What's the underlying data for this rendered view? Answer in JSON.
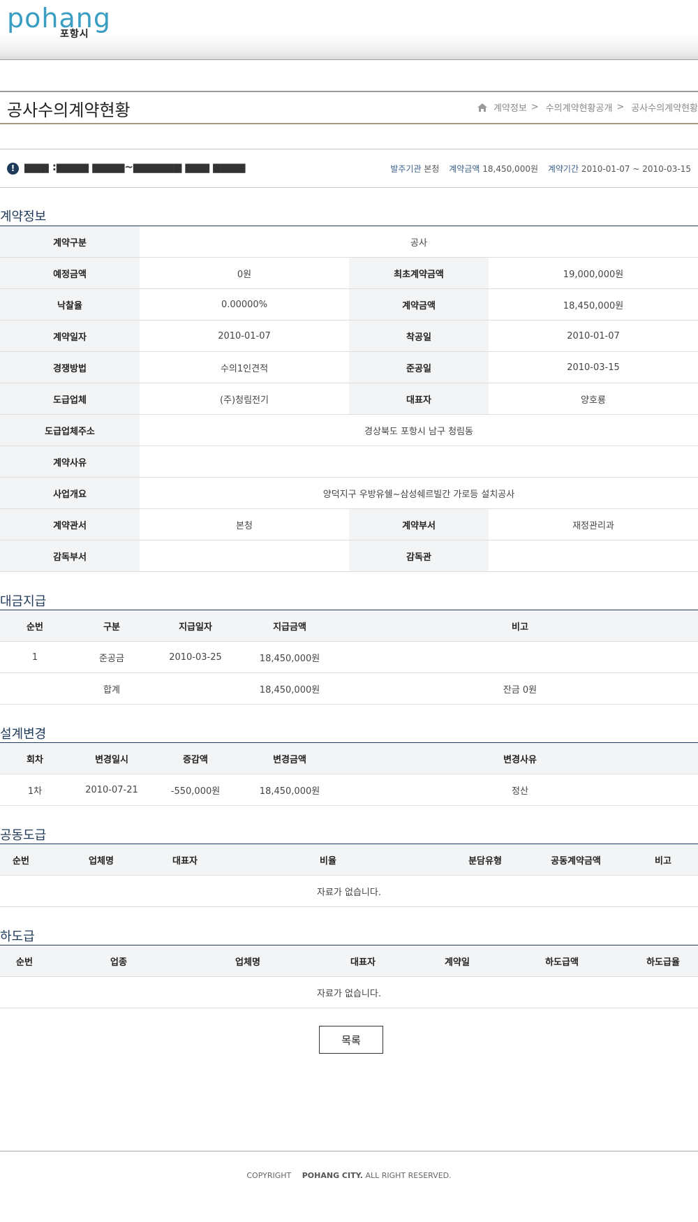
{
  "header": {
    "logo_text": "pohang",
    "logo_kor": "포항시"
  },
  "title_bar": {
    "title": "공사수의계약현황",
    "breadcrumb": [
      "계약정보",
      "수의계약현황공개",
      "공사수의계약현황"
    ],
    "separator": ">"
  },
  "summary": {
    "title": "▆▆▆ :▆▆▆▆ ▆▆▆▆~▆▆▆▆▆▆ ▆▆▆ ▆▆▆▆",
    "org_label": "발주기관",
    "org_value": "본청",
    "amount_label": "계약금액",
    "amount_value": "18,450,000원",
    "period_label": "계약기간",
    "period_value": "2010-01-07 ~ 2010-03-15"
  },
  "contract_info": {
    "heading": "계약정보",
    "type_label": "계약구분",
    "type_value": "공사",
    "est_label": "예정금액",
    "est_value": "0원",
    "first_amount_label": "최초계약금액",
    "first_amount_value": "19,000,000원",
    "rate_label": "낙찰율",
    "rate_value": "0.00000%",
    "amount_label": "계약금액",
    "amount_value": "18,450,000원",
    "date_label": "계약일자",
    "date_value": "2010-01-07",
    "start_label": "착공일",
    "start_value": "2010-01-07",
    "method_label": "경쟁방법",
    "method_value": "수의1인견적",
    "end_label": "준공일",
    "end_value": "2010-03-15",
    "company_label": "도급업체",
    "company_value": "(주)청림전기",
    "ceo_label": "대표자",
    "ceo_value": "양호룡",
    "address_label": "도급업체주소",
    "address_value": "경상북도 포항시 남구 청림동",
    "reason_label": "계약사유",
    "reason_value": "",
    "overview_label": "사업개요",
    "overview_value": "양덕지구 우방유쉘~삼성쉐르빌간 가로등 설치공사",
    "office_label": "계약관서",
    "office_value": "본청",
    "dept_label": "계약부서",
    "dept_value": "재정관리과",
    "sup_dept_label": "감독부서",
    "sup_dept_value": "",
    "supervisor_label": "감독관",
    "supervisor_value": ""
  },
  "payment": {
    "heading": "대금지급",
    "columns": [
      "순번",
      "구분",
      "지급일자",
      "지급금액",
      "비고"
    ],
    "rows": [
      [
        "1",
        "준공금",
        "2010-03-25",
        "18,450,000원",
        ""
      ]
    ],
    "total_label": "합계",
    "total_amount": "18,450,000원",
    "balance": "잔금 0원"
  },
  "design_change": {
    "heading": "설계변경",
    "columns": [
      "회차",
      "변경일시",
      "증감액",
      "변경금액",
      "변경사유"
    ],
    "rows": [
      [
        "1차",
        "2010-07-21",
        "-550,000원",
        "18,450,000원",
        "정산"
      ]
    ]
  },
  "joint": {
    "heading": "공동도급",
    "columns": [
      "순번",
      "업체명",
      "대표자",
      "비율",
      "분담유형",
      "공동계약금액",
      "비고"
    ],
    "empty": "자료가 없습니다."
  },
  "sub": {
    "heading": "하도급",
    "columns": [
      "순번",
      "업종",
      "업체명",
      "대표자",
      "계약일",
      "하도급액",
      "하도급율"
    ],
    "empty": "자료가 없습니다."
  },
  "list_button": "목록",
  "footer": {
    "copyright": "COPYRIGHT",
    "owner": "POHANG CITY.",
    "rights": "ALL RIGHT RESERVED."
  }
}
